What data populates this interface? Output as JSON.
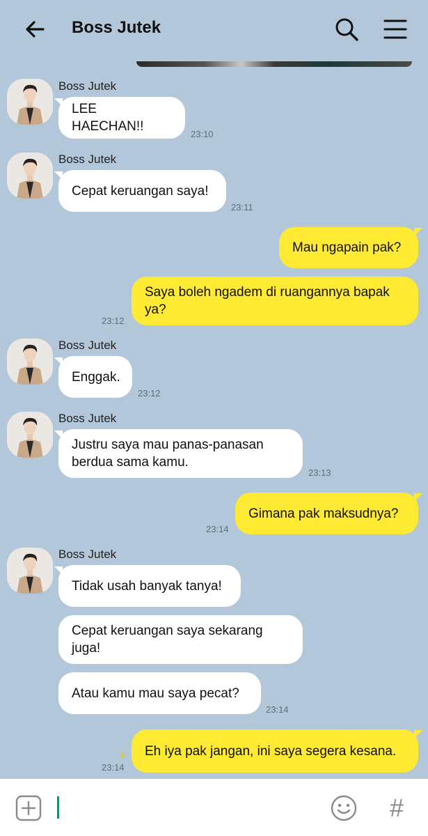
{
  "header": {
    "title": "Boss Jutek",
    "back_icon": "arrow-left-icon",
    "search_icon": "search-icon",
    "menu_icon": "hamburger-menu-icon"
  },
  "messages": [
    {
      "direction": "in",
      "sender": "Boss Jutek",
      "text": "LEE HAECHAN!!",
      "time": "23:10"
    },
    {
      "direction": "in",
      "sender": "Boss Jutek",
      "text": "Cepat keruangan saya!",
      "time": "23:11"
    },
    {
      "direction": "out",
      "text": "Mau ngapain pak?",
      "time": ""
    },
    {
      "direction": "out",
      "text": "Saya boleh ngadem di ruangannya bapak ya?",
      "time": "23:12"
    },
    {
      "direction": "in",
      "sender": "Boss Jutek",
      "text": "Enggak.",
      "time": "23:12"
    },
    {
      "direction": "in",
      "sender": "Boss Jutek",
      "text": "Justru saya mau panas-panasan berdua sama kamu.",
      "time": "23:13"
    },
    {
      "direction": "out",
      "text": "Gimana pak maksudnya?",
      "time": "23:14"
    },
    {
      "direction": "in",
      "sender": "Boss Jutek",
      "text": "Tidak usah banyak tanya!",
      "time": ""
    },
    {
      "direction": "in",
      "text": "Cepat keruangan saya sekarang juga!",
      "time": ""
    },
    {
      "direction": "in",
      "text": "Atau kamu mau saya pecat?",
      "time": "23:14"
    },
    {
      "direction": "out",
      "text": "Eh iya pak jangan, ini saya segera kesana.",
      "time": "23:14",
      "unread": "1"
    }
  ],
  "input_bar": {
    "plus_icon": "plus-square-icon",
    "emoji_icon": "smiley-icon",
    "hash_label": "#"
  },
  "colors": {
    "background": "#b2c7da",
    "incoming_bubble": "#ffffff",
    "outgoing_bubble": "#fee933"
  }
}
